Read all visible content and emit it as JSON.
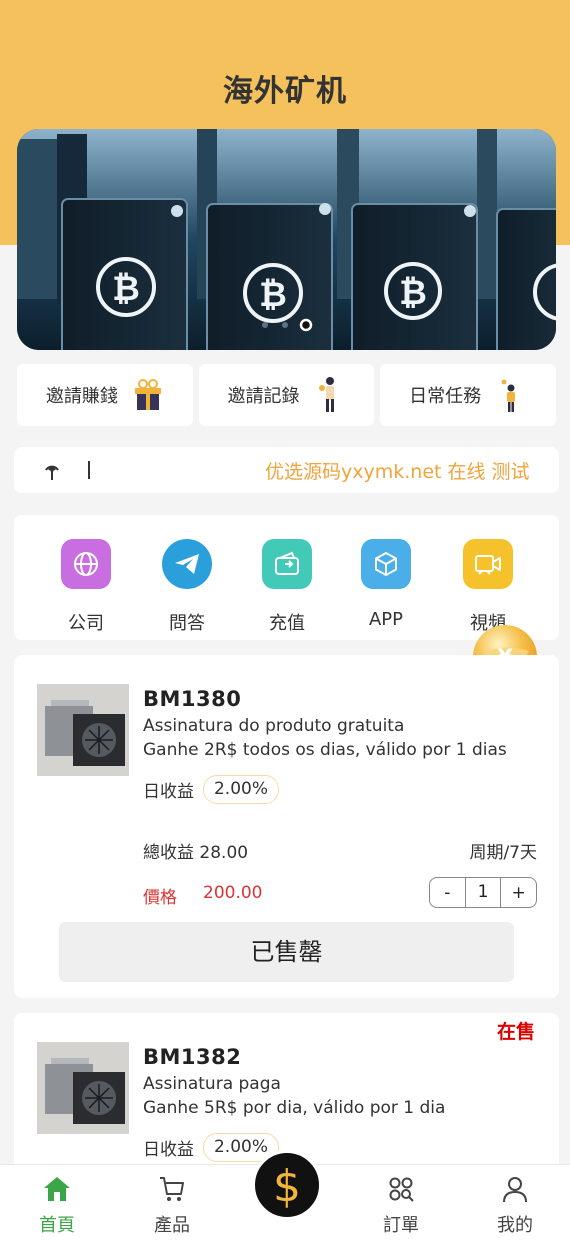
{
  "app": {
    "title": "海外矿机"
  },
  "banner": {
    "slide_count": 3,
    "active_slide": 3
  },
  "quick_links": [
    {
      "label": "邀請賺錢",
      "icon": "gift-icon"
    },
    {
      "label": "邀請記錄",
      "icon": "person-icon"
    },
    {
      "label": "日常任務",
      "icon": "task-person-icon"
    }
  ],
  "notice": {
    "text": "优选源码yxymk.net 在线 测试"
  },
  "menu": [
    {
      "label": "公司",
      "icon": "globe-icon",
      "color": "#c86ee0"
    },
    {
      "label": "問答",
      "icon": "telegram-icon",
      "color": "#2a9fdc"
    },
    {
      "label": "充值",
      "icon": "wallet-icon",
      "color": "#43c9b7"
    },
    {
      "label": "APP",
      "icon": "cube-icon",
      "color": "#4aaee8"
    },
    {
      "label": "視頻",
      "icon": "video-icon",
      "color": "#f5c22b"
    }
  ],
  "products": [
    {
      "name": "BM1380",
      "desc1": "Assinatura do produto gratuita",
      "desc2": "Ganhe 2R$ todos os dias, válido por 1 dias",
      "yield_label": "日收益",
      "yield_value": "2.00%",
      "total_label": "總收益 28.00",
      "period": "周期/7天",
      "price_label": "價格",
      "price": "200.00",
      "qty": "1",
      "button": "已售罄"
    },
    {
      "name": "BM1382",
      "status": "在售",
      "desc1": "Assinatura paga",
      "desc2": "Ganhe 5R$ por dia, válido por 1 dia",
      "yield_label": "日收益",
      "yield_value": "2.00%"
    }
  ],
  "tabbar": [
    {
      "label": "首頁",
      "icon": "home-icon",
      "active": true
    },
    {
      "label": "產品",
      "icon": "cart-icon",
      "active": false
    },
    {
      "label": "訂單",
      "icon": "grid-icon",
      "active": false
    },
    {
      "label": "我的",
      "icon": "user-icon",
      "active": false
    }
  ],
  "center_button": {
    "symbol": "$",
    "icon": "dollar-icon"
  },
  "colors": {
    "header": "#f4c15d",
    "accent": "#3aa648",
    "price": "#d33333",
    "marquee": "#f2a33c"
  }
}
